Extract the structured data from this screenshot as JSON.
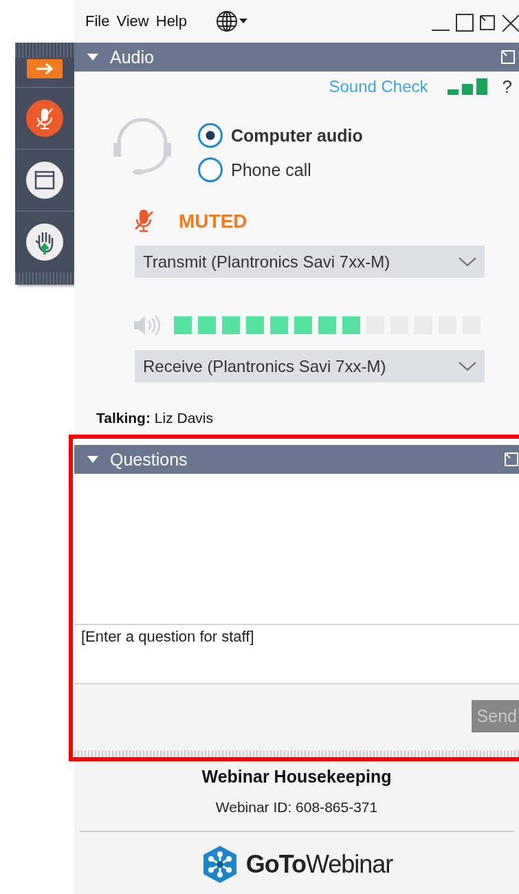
{
  "menu": [
    "File",
    "View",
    "Help"
  ],
  "audio": {
    "title": "Audio",
    "expanded": true,
    "sound_check": "Sound Check",
    "help": "?",
    "options": [
      {
        "label": "Computer audio",
        "selected": true
      },
      {
        "label": "Phone call",
        "selected": false
      }
    ],
    "muted": true,
    "muted_label": "MUTED",
    "transmit": "Transmit (Plantronics Savi 7xx-M)",
    "speaker": {
      "level": 0.62
    },
    "receive": "Receive (Plantronics Savi 7xx-M)",
    "talking": "**Talking:** Liz Davis"
  },
  "questions": {
    "title": "Questions",
    "expanded": true,
    "placeholder": "[Enter a question for staff]",
    "send": {
      "label": "Send",
      "disabled": true
    }
  },
  "footer": {
    "title": "Webinar Housekeeping",
    "webinar_id": "Webinar ID: 608-865-371",
    "logo": "**GoTo**Webinar"
  }
}
